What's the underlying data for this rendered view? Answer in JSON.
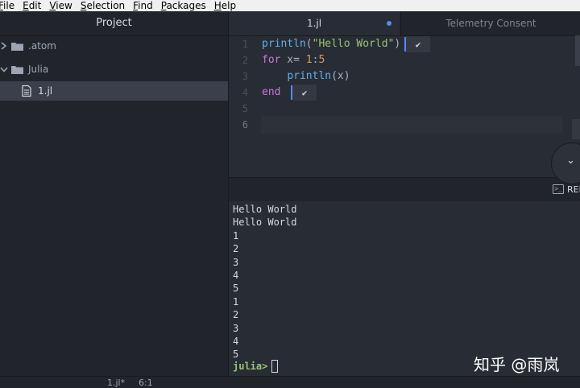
{
  "menu": [
    "File",
    "Edit",
    "View",
    "Selection",
    "Find",
    "Packages",
    "Help"
  ],
  "project": {
    "title": "Project",
    "items": [
      {
        "label": ".atom",
        "type": "folder",
        "state": "collapsed"
      },
      {
        "label": "Julia",
        "type": "folder",
        "state": "expanded"
      },
      {
        "label": "1.jl",
        "type": "file",
        "selected": true
      }
    ]
  },
  "tabs": [
    {
      "label": "1.jl",
      "active": true,
      "modified": true
    },
    {
      "label": "Telemetry Consent",
      "active": false
    }
  ],
  "editor": {
    "line_numbers": [
      "1",
      "2",
      "3",
      "4",
      "5",
      "6"
    ],
    "lines": [
      {
        "parts": [
          {
            "t": "println",
            "c": "fn"
          },
          {
            "t": "(",
            "c": ""
          },
          {
            "t": "\"Hello World\"",
            "c": "str"
          },
          {
            "t": ")",
            "c": ""
          }
        ]
      },
      {
        "parts": [
          {
            "t": "for",
            "c": "kw"
          },
          {
            "t": " x= ",
            "c": ""
          },
          {
            "t": "1",
            "c": "num"
          },
          {
            "t": ":",
            "c": ""
          },
          {
            "t": "5",
            "c": "num"
          }
        ]
      },
      {
        "parts": [
          {
            "t": "    ",
            "c": ""
          },
          {
            "t": "println",
            "c": "fn"
          },
          {
            "t": "(x)",
            "c": ""
          }
        ]
      },
      {
        "parts": [
          {
            "t": "end",
            "c": "kw"
          }
        ]
      },
      {
        "parts": []
      },
      {
        "parts": []
      }
    ],
    "inline_result_symbol": "✔"
  },
  "repl": {
    "tab_label": "REPL",
    "icon_text": ">_",
    "output": [
      "Hello World",
      "Hello World",
      "1",
      "2",
      "3",
      "4",
      "5",
      "1",
      "2",
      "3",
      "4",
      "5"
    ],
    "prompt": "julia>"
  },
  "watermark": "知乎 @雨岚",
  "status": {
    "file": "1.jl*",
    "position": "6:1"
  }
}
